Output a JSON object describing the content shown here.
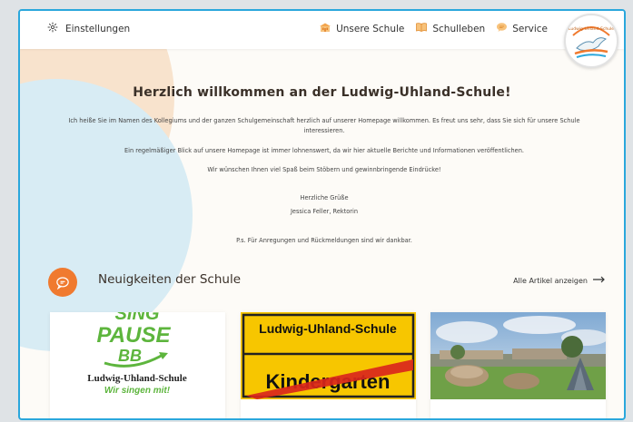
{
  "header": {
    "settings_label": "Einstellungen",
    "nav": [
      {
        "label": "Unsere Schule",
        "icon": "school-icon"
      },
      {
        "label": "Schulleben",
        "icon": "book-icon"
      },
      {
        "label": "Service",
        "icon": "chat-icon"
      }
    ],
    "logo_text": "Ludwig-Uhland-Schule Heilbronn"
  },
  "welcome": {
    "title": "Herzlich willkommen an der Ludwig-Uhland-Schule!",
    "p1": "Ich heiße Sie im Namen des Kollegiums und der ganzen Schulgemeinschaft herzlich auf unserer Homepage willkommen. Es freut uns sehr, dass Sie sich für unsere Schule interessieren.",
    "p2": "Ein regelmäßiger Blick auf unsere Homepage ist immer lohnenswert, da wir hier aktuelle Berichte und Informationen veröffentlichen.",
    "p3": "Wir wünschen Ihnen viel Spaß beim Stöbern und gewinnbringende Eindrücke!",
    "greeting": "Herzliche Grüße",
    "signature": "Jessica Feller, Rektorin",
    "ps": "P.s. Für Anregungen und Rückmeldungen sind wir dankbar."
  },
  "news": {
    "title": "Neuigkeiten der Schule",
    "all_articles": "Alle Artikel anzeigen",
    "cards": [
      {
        "top_text": "SING",
        "main_text": "PAUSE",
        "sub_text": "BB",
        "school": "Ludwig-Uhland-Schule",
        "motto": "Wir singen mit!"
      },
      {
        "sign_top": "Ludwig-Uhland-Schule",
        "sign_bottom": "Kindergarten"
      },
      {
        "image": "schoolyard-photo"
      }
    ]
  },
  "colors": {
    "accent_blue": "#2aa7dc",
    "accent_orange": "#f07a2f",
    "green": "#5db53d",
    "sign_yellow": "#f7c600",
    "sign_red": "#d9261c"
  }
}
